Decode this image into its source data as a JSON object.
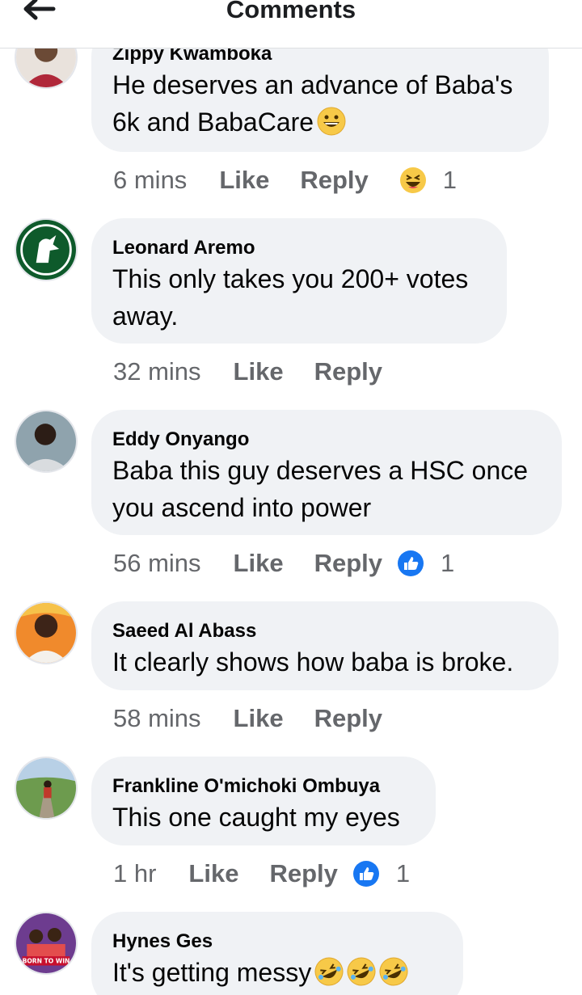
{
  "header": {
    "title": "Comments",
    "back_icon": "arrow-left-icon"
  },
  "actions": {
    "like": "Like",
    "reply": "Reply"
  },
  "comments": [
    {
      "author": "Zippy Kwamboka",
      "text": "He deserves an advance of Baba's 6k and BabaCare",
      "time": "6 mins",
      "reaction": "haha",
      "reaction_count": "1"
    },
    {
      "author": "Leonard Aremo",
      "text": "This only takes you 200+ votes away.",
      "time": "32 mins"
    },
    {
      "author": "Eddy Onyango",
      "text": "Baba this guy deserves a HSC once you ascend into power",
      "time": "56 mins",
      "reaction": "like",
      "reaction_count": "1"
    },
    {
      "author": "Saeed Al Abass",
      "text": "It clearly shows how baba is broke.",
      "time": "58 mins"
    },
    {
      "author": "Frankline O'michoki Ombuya",
      "text": "This one caught my eyes",
      "time": "1 hr",
      "reaction": "like",
      "reaction_count": "1"
    },
    {
      "author": "Hynes Ges",
      "text": "It's getting messy"
    }
  ],
  "avatar_badge_text": "BORN TO WIN",
  "colors": {
    "like_blue": "#1877f2",
    "bubble": "#f0f2f5",
    "secondary_text": "#65676b",
    "haha_yellow": "#f7c948"
  }
}
